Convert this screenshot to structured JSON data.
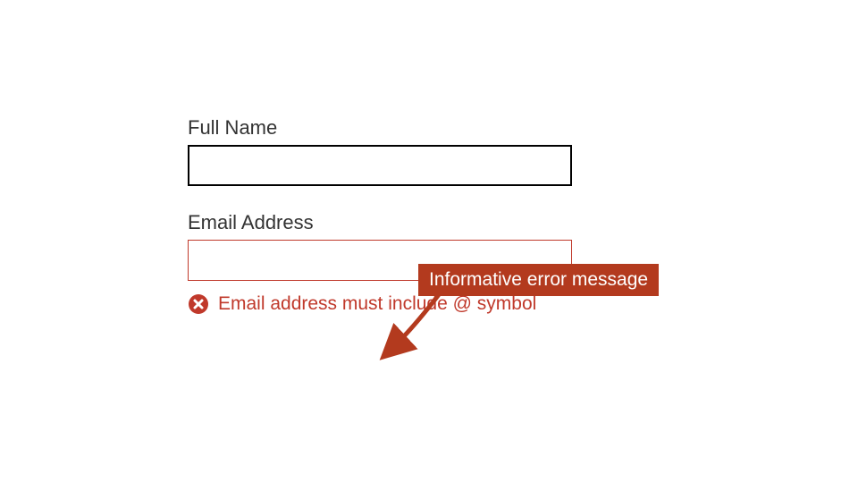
{
  "form": {
    "full_name": {
      "label": "Full Name",
      "value": ""
    },
    "email": {
      "label": "Email Address",
      "value": "",
      "error_message": "Email address must include @ symbol"
    }
  },
  "annotation": {
    "callout_label": "Informative error message"
  },
  "colors": {
    "error": "#c0392b",
    "callout_bg": "#b33a1e"
  }
}
